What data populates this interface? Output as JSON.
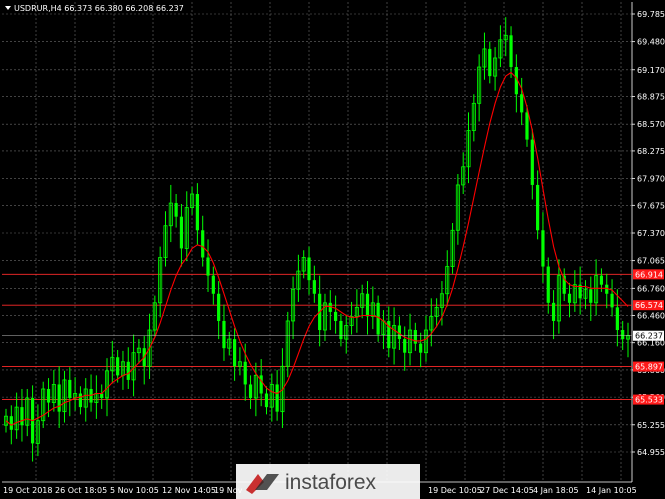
{
  "header": {
    "symbol_line": "USDRUR,H4  66.373 66.380 66.208 66.237"
  },
  "watermark": {
    "text": "instaforex",
    "icon": "instaforex-logo-icon"
  },
  "colors": {
    "background": "#000000",
    "grid": "#6b6b6b",
    "bull_candle": "#00ff00",
    "ma_line": "#ff0000",
    "level_line": "#ff2a2a",
    "price_marker": "#ff1a1a",
    "current_price_bg": "#ffffff",
    "current_price_text": "#000000"
  },
  "chart_data": {
    "type": "candlestick",
    "instrument": "USDRUR",
    "timeframe": "H4",
    "ylim": [
      64.9,
      69.9
    ],
    "y_ticks": [
      "69.785",
      "69.480",
      "69.170",
      "68.875",
      "68.570",
      "68.275",
      "67.970",
      "67.675",
      "67.370",
      "67.065",
      "66.760",
      "66.460",
      "66.160",
      "65.860",
      "65.560",
      "65.255",
      "64.955"
    ],
    "x_ticks": [
      "19 Oct 2018",
      "26 Oct 18:05",
      "5 Nov 10:05",
      "12 Nov 14:05",
      "19 Nov",
      "19 Dec 10:05",
      "27 Dec 14:05",
      "4 Jan 18:05",
      "14 Jan 10:05"
    ],
    "current_price": "66.237",
    "levels": [
      {
        "value": 66.914,
        "label": "66.914"
      },
      {
        "value": 66.574,
        "label": "66.574"
      },
      {
        "value": 65.897,
        "label": "65.897"
      },
      {
        "value": 65.533,
        "label": "65.533"
      }
    ],
    "close_series": [
      65.35,
      65.2,
      65.45,
      65.25,
      65.55,
      65.05,
      65.3,
      65.65,
      65.5,
      65.7,
      65.4,
      65.75,
      65.55,
      65.6,
      65.45,
      65.65,
      65.5,
      65.6,
      65.55,
      65.85,
      66.0,
      65.8,
      65.95,
      65.75,
      66.05,
      66.1,
      65.9,
      66.3,
      66.6,
      67.1,
      67.45,
      67.7,
      67.55,
      67.2,
      67.65,
      67.8,
      67.4,
      67.1,
      66.9,
      66.7,
      66.4,
      66.1,
      66.2,
      65.9,
      65.95,
      65.7,
      65.55,
      65.8,
      65.6,
      65.45,
      65.7,
      65.4,
      65.9,
      66.4,
      66.75,
      66.95,
      67.1,
      66.85,
      66.7,
      66.3,
      66.6,
      66.5,
      66.4,
      66.2,
      66.35,
      66.45,
      66.55,
      66.7,
      66.45,
      66.6,
      66.25,
      66.4,
      66.1,
      66.35,
      66.2,
      66.05,
      66.3,
      66.15,
      66.05,
      66.3,
      66.45,
      66.55,
      66.7,
      67.0,
      67.4,
      67.9,
      68.1,
      68.5,
      68.8,
      69.2,
      69.4,
      69.1,
      69.3,
      69.5,
      69.55,
      69.2,
      68.9,
      68.7,
      68.4,
      67.9,
      67.4,
      67.0,
      66.6,
      66.4,
      66.9,
      66.7,
      66.6,
      66.8,
      66.65,
      66.75,
      66.6,
      66.9,
      66.8,
      66.7,
      66.55,
      66.3,
      66.2,
      66.24
    ],
    "ma_series": [
      65.3,
      65.25,
      65.28,
      65.3,
      65.32,
      65.3,
      65.33,
      65.36,
      65.4,
      65.44,
      65.46,
      65.5,
      65.52,
      65.55,
      65.56,
      65.58,
      65.58,
      65.6,
      65.6,
      65.66,
      65.72,
      65.76,
      65.8,
      65.82,
      65.88,
      65.94,
      66.0,
      66.1,
      66.22,
      66.38,
      66.56,
      66.74,
      66.9,
      67.02,
      67.1,
      67.2,
      67.24,
      67.22,
      67.16,
      67.04,
      66.88,
      66.7,
      66.52,
      66.34,
      66.18,
      66.04,
      65.92,
      65.82,
      65.74,
      65.66,
      65.62,
      65.6,
      65.64,
      65.74,
      65.88,
      66.04,
      66.2,
      66.34,
      66.44,
      66.5,
      66.56,
      66.56,
      66.54,
      66.5,
      66.46,
      66.44,
      66.44,
      66.46,
      66.46,
      66.46,
      66.44,
      66.4,
      66.34,
      66.3,
      66.26,
      66.22,
      66.2,
      66.18,
      66.18,
      66.2,
      66.26,
      66.34,
      66.44,
      66.58,
      66.76,
      66.98,
      67.22,
      67.48,
      67.76,
      68.04,
      68.32,
      68.58,
      68.8,
      68.98,
      69.1,
      69.14,
      69.08,
      68.96,
      68.76,
      68.5,
      68.2,
      67.86,
      67.52,
      67.22,
      67.0,
      66.86,
      66.8,
      66.78,
      66.78,
      66.78,
      66.76,
      66.76,
      66.76,
      66.76,
      66.74,
      66.68,
      66.62,
      66.56
    ]
  }
}
